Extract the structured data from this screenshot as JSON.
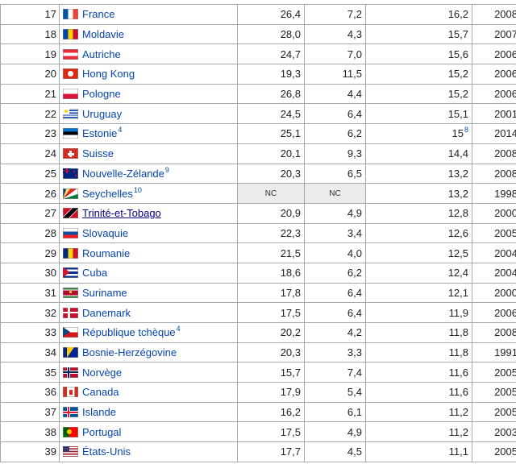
{
  "rows": [
    {
      "rank": "17",
      "country": "France",
      "flag": "flag-france-icon",
      "ref": "",
      "v1": "26,4",
      "v2": "7,2",
      "v3": "16,2",
      "v3ref": "",
      "year": "2008"
    },
    {
      "rank": "18",
      "country": "Moldavie",
      "flag": "flag-moldova-icon",
      "ref": "",
      "v1": "28,0",
      "v2": "4,3",
      "v3": "15,7",
      "v3ref": "",
      "year": "2007"
    },
    {
      "rank": "19",
      "country": "Autriche",
      "flag": "flag-austria-icon",
      "ref": "",
      "v1": "24,7",
      "v2": "7,0",
      "v3": "15,6",
      "v3ref": "",
      "year": "2006"
    },
    {
      "rank": "20",
      "country": "Hong Kong",
      "flag": "flag-hong-kong-icon",
      "ref": "",
      "v1": "19,3",
      "v2": "11,5",
      "v3": "15,2",
      "v3ref": "",
      "year": "2006"
    },
    {
      "rank": "21",
      "country": "Pologne",
      "flag": "flag-poland-icon",
      "ref": "",
      "v1": "26,8",
      "v2": "4,4",
      "v3": "15,2",
      "v3ref": "",
      "year": "2006"
    },
    {
      "rank": "22",
      "country": "Uruguay",
      "flag": "flag-uruguay-icon",
      "ref": "",
      "v1": "24,5",
      "v2": "6,4",
      "v3": "15,1",
      "v3ref": "",
      "year": "2001"
    },
    {
      "rank": "23",
      "country": "Estonie",
      "flag": "flag-estonia-icon",
      "ref": "4",
      "v1": "25,1",
      "v2": "6,2",
      "v3": "15",
      "v3ref": "8",
      "year": "2014"
    },
    {
      "rank": "24",
      "country": "Suisse",
      "flag": "flag-switzerland-icon",
      "ref": "",
      "v1": "20,1",
      "v2": "9,3",
      "v3": "14,4",
      "v3ref": "",
      "year": "2008"
    },
    {
      "rank": "25",
      "country": "Nouvelle-Zélande",
      "flag": "flag-new-zealand-icon",
      "ref": "9",
      "v1": "20,3",
      "v2": "6,5",
      "v3": "13,2",
      "v3ref": "",
      "year": "2008"
    },
    {
      "rank": "26",
      "country": "Seychelles",
      "flag": "flag-seychelles-icon",
      "ref": "10",
      "v1": "NC",
      "v2": "NC",
      "v3": "13,2",
      "v3ref": "",
      "year": "1998"
    },
    {
      "rank": "27",
      "country": "Trinité-et-Tobago",
      "flag": "flag-trinidad-tobago-icon",
      "ref": "",
      "v1": "20,9",
      "v2": "4,9",
      "v3": "12,8",
      "v3ref": "",
      "year": "2000"
    },
    {
      "rank": "28",
      "country": "Slovaquie",
      "flag": "flag-slovakia-icon",
      "ref": "",
      "v1": "22,3",
      "v2": "3,4",
      "v3": "12,6",
      "v3ref": "",
      "year": "2005"
    },
    {
      "rank": "29",
      "country": "Roumanie",
      "flag": "flag-romania-icon",
      "ref": "",
      "v1": "21,5",
      "v2": "4,0",
      "v3": "12,5",
      "v3ref": "",
      "year": "2004"
    },
    {
      "rank": "30",
      "country": "Cuba",
      "flag": "flag-cuba-icon",
      "ref": "",
      "v1": "18,6",
      "v2": "6,2",
      "v3": "12,4",
      "v3ref": "",
      "year": "2004"
    },
    {
      "rank": "31",
      "country": "Suriname",
      "flag": "flag-suriname-icon",
      "ref": "",
      "v1": "17,8",
      "v2": "6,4",
      "v3": "12,1",
      "v3ref": "",
      "year": "2000"
    },
    {
      "rank": "32",
      "country": "Danemark",
      "flag": "flag-denmark-icon",
      "ref": "",
      "v1": "17,5",
      "v2": "6,4",
      "v3": "11,9",
      "v3ref": "",
      "year": "2006"
    },
    {
      "rank": "33",
      "country": "République tchèque",
      "flag": "flag-czech-republic-icon",
      "ref": "4",
      "v1": "20,2",
      "v2": "4,2",
      "v3": "11,8",
      "v3ref": "",
      "year": "2008"
    },
    {
      "rank": "34",
      "country": "Bosnie-Herzégovine",
      "flag": "flag-bosnia-icon",
      "ref": "",
      "v1": "20,3",
      "v2": "3,3",
      "v3": "11,8",
      "v3ref": "",
      "year": "1991"
    },
    {
      "rank": "35",
      "country": "Norvège",
      "flag": "flag-norway-icon",
      "ref": "",
      "v1": "15,7",
      "v2": "7,4",
      "v3": "11,6",
      "v3ref": "",
      "year": "2005"
    },
    {
      "rank": "36",
      "country": "Canada",
      "flag": "flag-canada-icon",
      "ref": "",
      "v1": "17,9",
      "v2": "5,4",
      "v3": "11,6",
      "v3ref": "",
      "year": "2005"
    },
    {
      "rank": "37",
      "country": "Islande",
      "flag": "flag-iceland-icon",
      "ref": "",
      "v1": "16,2",
      "v2": "6,1",
      "v3": "11,2",
      "v3ref": "",
      "year": "2005"
    },
    {
      "rank": "38",
      "country": "Portugal",
      "flag": "flag-portugal-icon",
      "ref": "",
      "v1": "17,5",
      "v2": "4,9",
      "v3": "11,2",
      "v3ref": "",
      "year": "2003"
    },
    {
      "rank": "39",
      "country": "États-Unis",
      "flag": "flag-united-states-icon",
      "ref": "",
      "v1": "17,7",
      "v2": "4,5",
      "v3": "11,1",
      "v3ref": "",
      "year": "2005"
    }
  ]
}
